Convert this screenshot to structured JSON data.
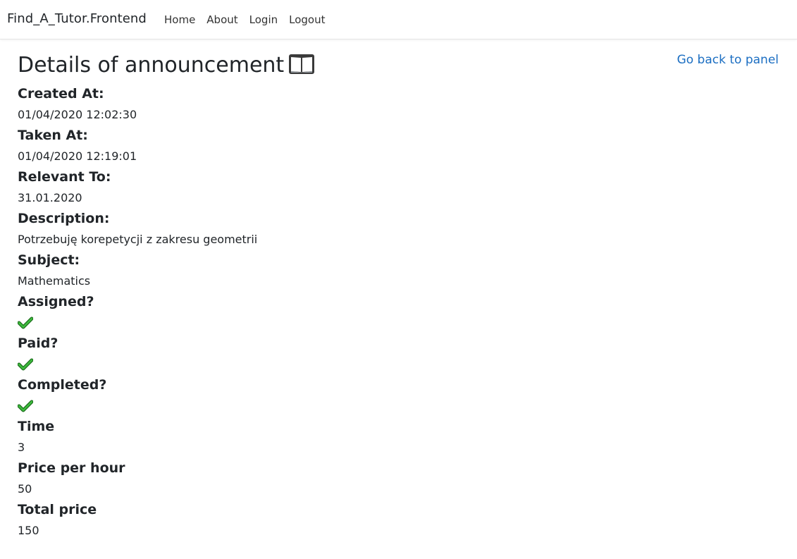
{
  "navbar": {
    "brand": "Find_A_Tutor.Frontend",
    "links": [
      "Home",
      "About",
      "Login",
      "Logout"
    ]
  },
  "page": {
    "title": "Details of announcement",
    "title_icon": "open-book-icon",
    "back_link": "Go back to panel"
  },
  "fields": {
    "created_at": {
      "label": "Created At:",
      "value": "01/04/2020 12:02:30"
    },
    "taken_at": {
      "label": "Taken At:",
      "value": "01/04/2020 12:19:01"
    },
    "relevant_to": {
      "label": "Relevant To:",
      "value": "31.01.2020"
    },
    "description": {
      "label": "Description:",
      "value": "Potrzebuję korepetycji z zakresu geometrii"
    },
    "subject": {
      "label": "Subject:",
      "value": "Mathematics"
    },
    "assigned": {
      "label": "Assigned?",
      "value": true,
      "icon": "check-mark-icon"
    },
    "paid": {
      "label": "Paid?",
      "value": true,
      "icon": "check-mark-icon"
    },
    "completed": {
      "label": "Completed?",
      "value": true,
      "icon": "check-mark-icon"
    },
    "time": {
      "label": "Time",
      "value": "3"
    },
    "price_per_hour": {
      "label": "Price per hour",
      "value": "50"
    },
    "total_price": {
      "label": "Total price",
      "value": "150"
    }
  },
  "colors": {
    "link": "#1b6ec2",
    "check": "#2e9e2e"
  }
}
